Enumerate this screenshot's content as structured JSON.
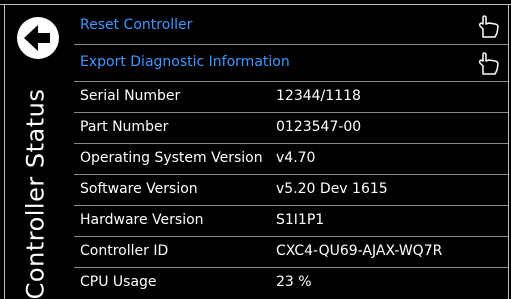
{
  "sidebar": {
    "title": "Controller Status",
    "back_icon": "back-arrow-icon"
  },
  "actions": [
    {
      "label": "Reset Controller",
      "icon": "hand-pointer-icon"
    },
    {
      "label": "Export Diagnostic Information",
      "icon": "hand-pointer-icon"
    }
  ],
  "info": [
    {
      "key": "Serial Number",
      "value": "12344/1118"
    },
    {
      "key": "Part Number",
      "value": "0123547-00"
    },
    {
      "key": "Operating System Version",
      "value": "v4.70"
    },
    {
      "key": "Software Version",
      "value": "v5.20 Dev 1615"
    },
    {
      "key": "Hardware Version",
      "value": "S1I1P1"
    },
    {
      "key": "Controller ID",
      "value": "CXC4-QU69-AJAX-WQ7R"
    },
    {
      "key": "CPU Usage",
      "value": "23 %"
    }
  ],
  "colors": {
    "background": "#000000",
    "action_text": "#3f97ff",
    "text": "#ffffff",
    "divider": "#8a8a8a"
  }
}
